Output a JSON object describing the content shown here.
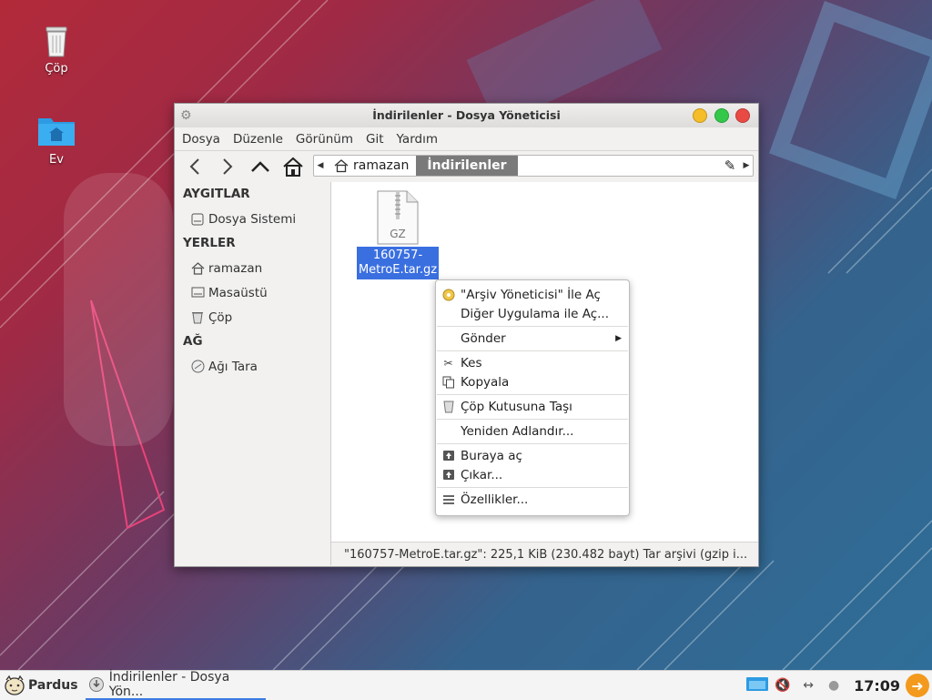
{
  "desktop": {
    "icons": [
      {
        "label": "Çöp",
        "icon": "trash-icon"
      },
      {
        "label": "Ev",
        "icon": "home-folder-icon"
      }
    ]
  },
  "window": {
    "title": "İndirilenler - Dosya Yöneticisi",
    "menu": [
      "Dosya",
      "Düzenle",
      "Görünüm",
      "Git",
      "Yardım"
    ],
    "path": [
      "ramazan",
      "İndirilenler"
    ],
    "sidebar": {
      "sections": [
        {
          "title": "AYGITLAR",
          "items": [
            "Dosya Sistemi"
          ]
        },
        {
          "title": "YERLER",
          "items": [
            "ramazan",
            "Masaüstü",
            "Çöp"
          ]
        },
        {
          "title": "AĞ",
          "items": [
            "Ağı Tara"
          ]
        }
      ]
    },
    "file": {
      "badge": "GZ",
      "name_line1": "160757-",
      "name_line2": "MetroE.tar.gz"
    },
    "status": "\"160757-MetroE.tar.gz\": 225,1 KiB (230.482 bayt) Tar arşivi (gzip i..."
  },
  "context_menu": {
    "items": [
      "\"Arşiv Yöneticisi\" İle Aç",
      "Diğer Uygulama ile Aç...",
      "Gönder",
      "Kes",
      "Kopyala",
      "Çöp Kutusuna Taşı",
      "Yeniden Adlandır...",
      "Buraya aç",
      "Çıkar...",
      "Özellikler..."
    ]
  },
  "taskbar": {
    "start_label": "Pardus",
    "task_label": "İndirilenler - Dosya Yön...",
    "clock": "17:09"
  }
}
